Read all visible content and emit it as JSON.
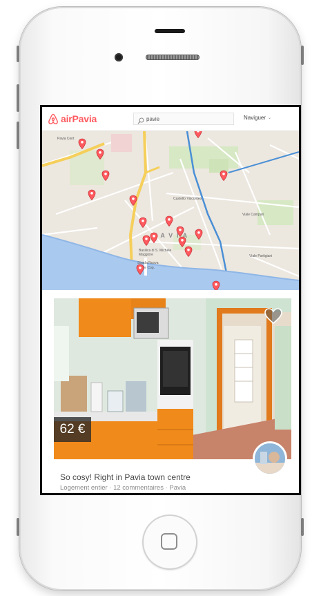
{
  "app": {
    "brand": "airPavia",
    "brand_color": "#ff5a5f"
  },
  "search": {
    "value": "pavie",
    "icon": "search-icon"
  },
  "nav": {
    "menu_label": "Naviguer",
    "menu_icon": "chevron-down-icon"
  },
  "map": {
    "labels": {
      "paria_cent": "Pavia Cent",
      "castello": "Castello Visconteo",
      "city": "PAVIA",
      "basilica": "Basilica di S. Michele Maggiore",
      "strada": "Strada Nuova",
      "ponte": "Ponte Cop.",
      "campari": "Viale Campari",
      "partigiani": "Viale Partigiani",
      "pin_icon": "map-pin-icon"
    }
  },
  "listing": {
    "price": "62 €",
    "title": "So cosy! Right in Pavia town centre",
    "subtitle": "Logement entier · 12 commentaires · Pavia",
    "favorite_icon": "heart-icon"
  }
}
